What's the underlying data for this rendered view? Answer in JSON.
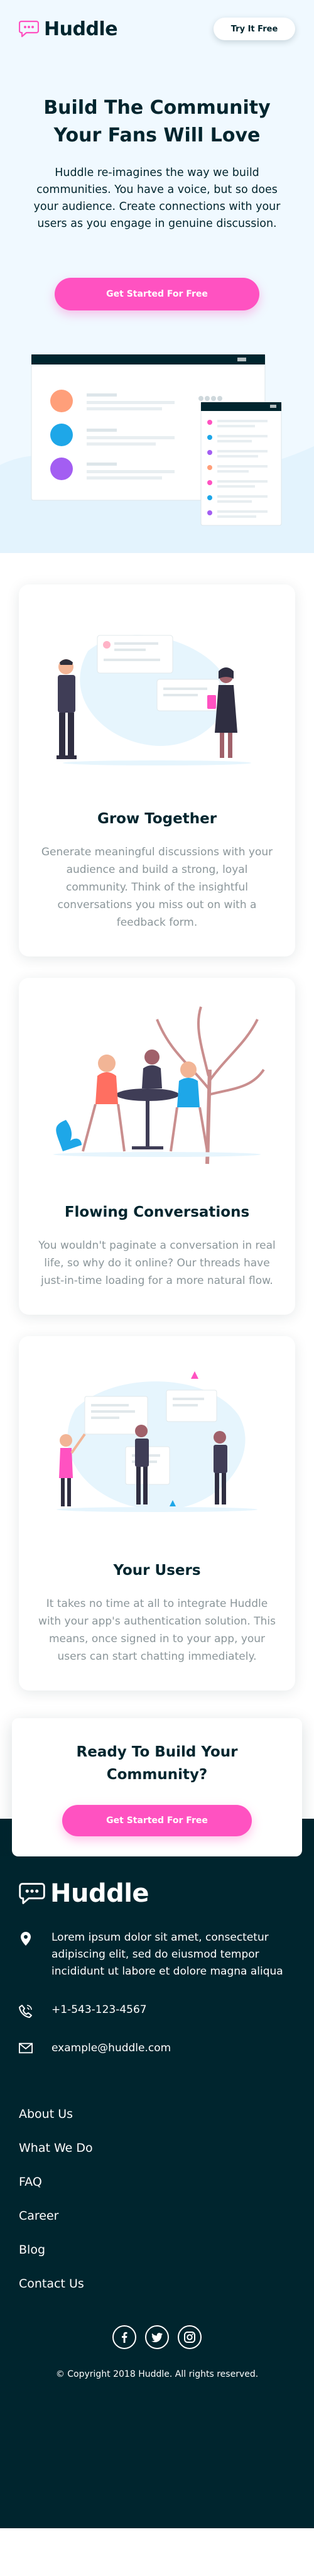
{
  "brand": {
    "name": "Huddle",
    "accent": "#ff52c1",
    "dark": "#00252e",
    "muted": "#8b969a"
  },
  "header": {
    "try_label": "Try It Free"
  },
  "hero": {
    "title": "Build The Community Your Fans Will Love",
    "description": "Huddle re-imagines the way we build communities. You have a voice, but so does your audience. Create connections with your users as you engage in genuine discussion.",
    "cta_label": "Get Started For Free"
  },
  "features": [
    {
      "title": "Grow Together",
      "text": "Generate meaningful discussions with your audience and build a strong, loyal community. Think of the insightful conversations you miss out on with a feedback form.",
      "illustration": "grow-together-illustration"
    },
    {
      "title": "Flowing Conversations",
      "text": "You wouldn't paginate a conversation in real life, so why do it online? Our threads have just-in-time loading for a more natural flow.",
      "illustration": "flowing-conversation-illustration"
    },
    {
      "title": "Your Users",
      "text": "It takes no time at all to integrate Huddle with your app's authentication solution. This means, once signed in to your app, your users can start chatting immediately.",
      "illustration": "your-users-illustration"
    }
  ],
  "ready": {
    "title": "Ready To Build Your Community?",
    "cta_label": "Get Started For Free"
  },
  "footer": {
    "address": "Lorem ipsum dolor sit amet, consectetur adipiscing elit, sed do eiusmod tempor incididunt ut labore et dolore magna aliqua",
    "phone": "+1-543-123-4567",
    "email": "example@huddle.com",
    "nav": [
      "About Us",
      "What We Do",
      "FAQ",
      "Career",
      "Blog",
      "Contact Us"
    ],
    "social": [
      "facebook-icon",
      "twitter-icon",
      "instagram-icon"
    ],
    "copyright": "© Copyright 2018 Huddle. All rights reserved."
  }
}
